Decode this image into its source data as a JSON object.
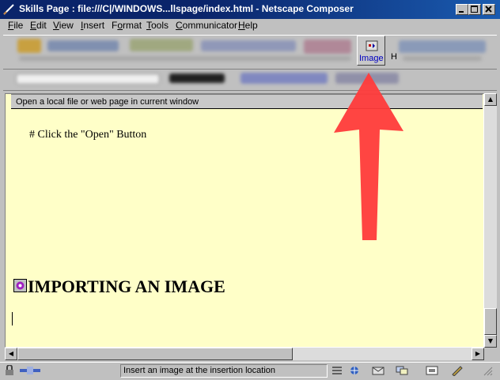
{
  "window": {
    "title": "Skills Page : file:///C|/WINDOWS...llspage/index.html - Netscape Composer",
    "controls": [
      "minimize-icon",
      "maximize-icon",
      "close-icon"
    ]
  },
  "menu": [
    {
      "label": "File",
      "key": "F"
    },
    {
      "label": "Edit",
      "key": "E"
    },
    {
      "label": "View",
      "key": "V"
    },
    {
      "label": "Insert",
      "key": "I"
    },
    {
      "label": "Format",
      "key": "o"
    },
    {
      "label": "Tools",
      "key": "T"
    },
    {
      "label": "Communicator",
      "key": "C"
    },
    {
      "label": "Help",
      "key": "H"
    }
  ],
  "toolbar": {
    "image_label": "Image",
    "next_partial": "H"
  },
  "tooltip": "Open a local file or web page in current window",
  "document": {
    "step": "#   Click the \"Open\" Button",
    "heading": "IMPORTING AN IMAGE"
  },
  "status": {
    "text": "Insert an image at the insertion location"
  },
  "colors": {
    "document_bg": "#ffffc8",
    "arrow": "#ff3333",
    "titlebar": "#0a246a"
  }
}
